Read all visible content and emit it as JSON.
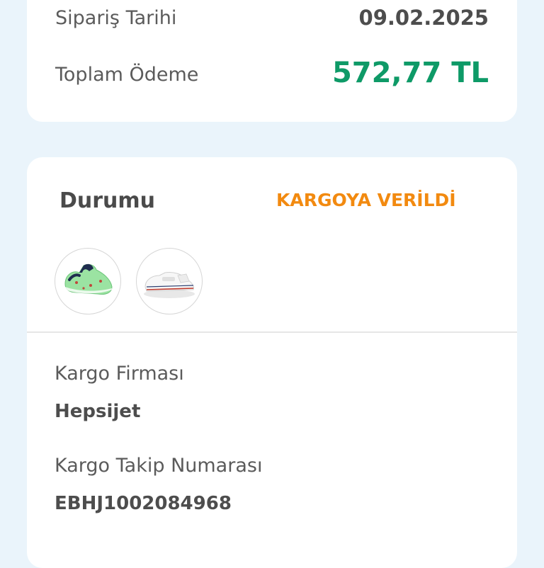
{
  "summary": {
    "order_date_label": "Sipariş Tarihi",
    "order_date_value": "09.02.2025",
    "total_label": "Toplam Ödeme",
    "total_value": "572,77 TL"
  },
  "shipment": {
    "status_label": "Durumu",
    "status_value": "KARGOYA VERİLDİ",
    "products": [
      {
        "icon": "green-baby-shoe-thumbnail"
      },
      {
        "icon": "white-sneaker-thumbnail"
      }
    ],
    "carrier_label": "Kargo Firması",
    "carrier_value": "Hepsijet",
    "tracking_label": "Kargo Takip Numarası",
    "tracking_value": "EBHJ1002084968"
  },
  "colors": {
    "background": "#eaf4fb",
    "card": "#ffffff",
    "total_green": "#0e9a67",
    "status_orange": "#f28a10",
    "text_gray": "#5b5b5b"
  }
}
